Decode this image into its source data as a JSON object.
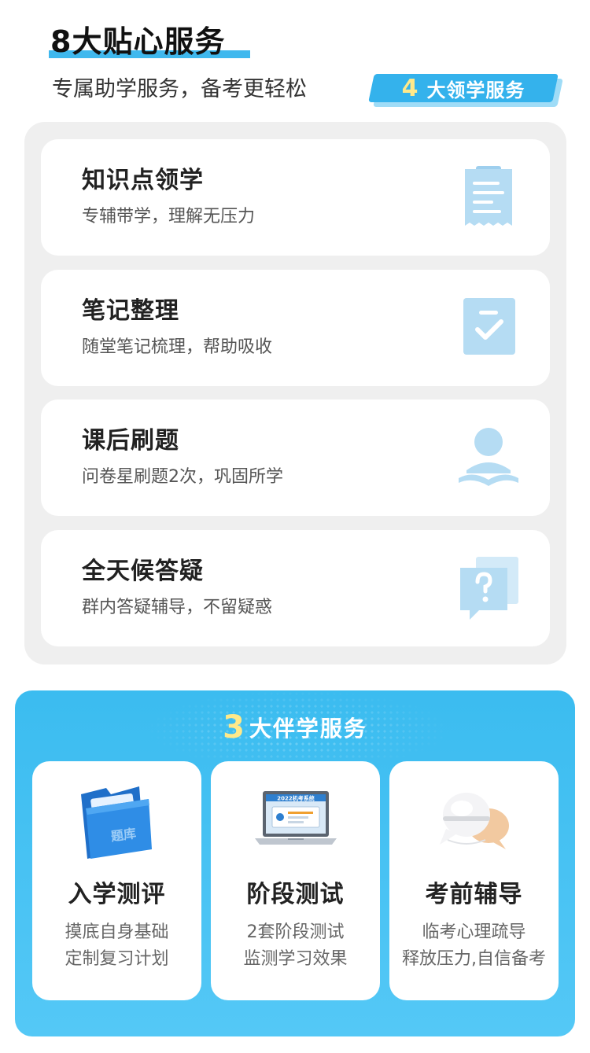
{
  "header": {
    "title": "8大贴心服务",
    "subtitle": "专属助学服务，备考更轻松",
    "badge_number": "4",
    "badge_label": "大领学服务"
  },
  "lead_services": [
    {
      "title": "知识点领学",
      "desc": "专辅带学，理解无压力",
      "icon": "document-icon"
    },
    {
      "title": "笔记整理",
      "desc": "随堂笔记梳理，帮助吸收",
      "icon": "checklist-icon"
    },
    {
      "title": "课后刷题",
      "desc": "问卷星刷题2次，巩固所学",
      "icon": "reader-icon"
    },
    {
      "title": "全天候答疑",
      "desc": "群内答疑辅导，不留疑惑",
      "icon": "question-chat-icon"
    }
  ],
  "companion": {
    "number": "3",
    "label": "大伴学服务",
    "cards": [
      {
        "title": "入学测评",
        "desc1": "摸底自身基础",
        "desc2": "定制复习计划",
        "icon": "folder-icon",
        "folder_text": "题库"
      },
      {
        "title": "阶段测试",
        "desc1": "2套阶段测试",
        "desc2": "监测学习效果",
        "icon": "laptop-icon",
        "screen_text": "2022机考系统"
      },
      {
        "title": "考前辅导",
        "desc1": "临考心理疏导",
        "desc2": "释放压力,自信备考",
        "icon": "chat-bubbles-icon"
      }
    ]
  },
  "colors": {
    "accent": "#3fb8ee",
    "icon_fill": "#b5dcf3",
    "highlight_yellow": "#ffe98a"
  }
}
